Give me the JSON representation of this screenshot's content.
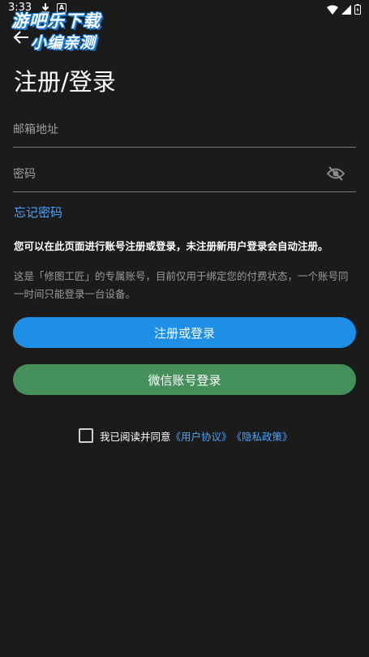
{
  "status_bar": {
    "time": "3:33",
    "notification_letter": "A"
  },
  "watermark": {
    "line1": "游吧乐下载",
    "line2": "小编亲测"
  },
  "header": {
    "title": "注册/登录"
  },
  "form": {
    "email_placeholder": "邮箱地址",
    "password_placeholder": "密码",
    "forgot_password": "忘记密码"
  },
  "notice": {
    "bold": "您可以在此页面进行账号注册或登录，未注册新用户登录会自动注册。",
    "description": "这是「修图工匠」的专属账号，目前仅用于绑定您的付费状态，一个账号同一时间只能登录一台设备。"
  },
  "buttons": {
    "login": "注册或登录",
    "wechat": "微信账号登录"
  },
  "agreement": {
    "prefix": "我已阅读并同意",
    "user_agreement": "《用户协议》",
    "privacy_policy": "《隐私政策》"
  },
  "colors": {
    "background": "#1b1b1b",
    "primary": "#1e8fe6",
    "wechat": "#45905a",
    "link": "#4aa3ff"
  }
}
